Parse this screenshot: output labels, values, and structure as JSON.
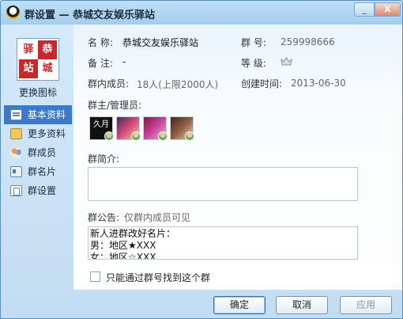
{
  "window": {
    "title": "群设置 — 恭城交友娱乐驿站"
  },
  "titlebar": {
    "minimize": "_",
    "close": "X"
  },
  "sidebar": {
    "logo_chars": [
      "驿",
      "恭",
      "站",
      "城"
    ],
    "change_icon_label": "更换图标",
    "items": [
      {
        "label": "基本资料",
        "icon": "info-icon",
        "active": true
      },
      {
        "label": "更多资料",
        "icon": "more-info-icon",
        "active": false
      },
      {
        "label": "群成员",
        "icon": "members-icon",
        "active": false
      },
      {
        "label": "群名片",
        "icon": "card-icon",
        "active": false
      },
      {
        "label": "群设置",
        "icon": "settings-icon",
        "active": false
      }
    ]
  },
  "info": {
    "name_label": "名  称:",
    "name_value": "恭城交友娱乐驿站",
    "number_label": "群  号:",
    "number_value": "259998666",
    "remark_label": "备  注:",
    "remark_value": "-",
    "level_label": "等  级:",
    "members_label": "群内成员:",
    "members_value": "18人(上限2000人)",
    "created_label": "创建时间:",
    "created_value": "2013-06-30"
  },
  "admins": {
    "label": "群主/管理员:",
    "avatars": [
      {
        "name": "admin-avatar-1",
        "text": "久月"
      },
      {
        "name": "admin-avatar-2"
      },
      {
        "name": "admin-avatar-3"
      },
      {
        "name": "admin-avatar-4"
      }
    ]
  },
  "intro": {
    "label": "群简介:",
    "text": ""
  },
  "notice": {
    "label": "群公告:",
    "hint": "仅群内成员可见",
    "lines": [
      "新人进群改好名片：",
      "男：地区★XXX",
      "女：地区☆XXX"
    ]
  },
  "search_option": {
    "label": "只能通过群号找到这个群",
    "checked": false
  },
  "buttons": {
    "ok": "确定",
    "cancel": "取消",
    "apply": "应用"
  }
}
